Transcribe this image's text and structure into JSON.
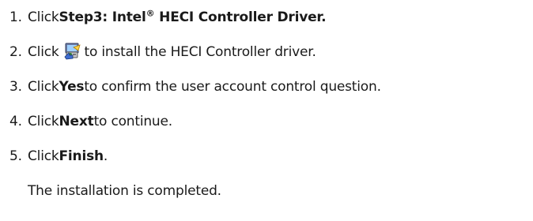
{
  "steps": [
    {
      "number": "1.",
      "pre": "Click ",
      "bold": "Step3: Intel",
      "reg_mark": "®",
      "bold_after": " HECI Controller Driver."
    },
    {
      "number": "2.",
      "pre": "Click ",
      "icon": "install-setup-icon",
      "post": " to install the HECI Controller driver."
    },
    {
      "number": "3.",
      "pre": "Click ",
      "bold": "Yes",
      "post": " to confirm the user account control question."
    },
    {
      "number": "4.",
      "pre": "Click ",
      "bold": "Next",
      "post": " to continue."
    },
    {
      "number": "5.",
      "pre": "Click ",
      "bold": "Finish",
      "post": "."
    }
  ],
  "result_note": "The installation is completed."
}
